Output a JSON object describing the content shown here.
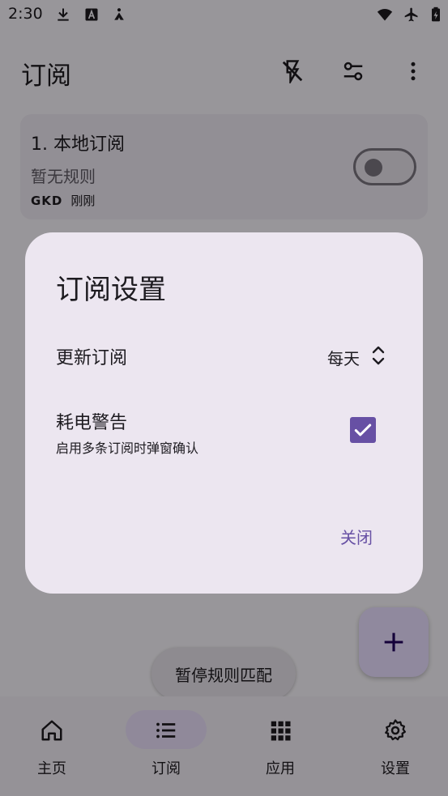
{
  "status_bar": {
    "time": "2:30",
    "left_icons": [
      "download-icon",
      "font-a-icon",
      "accessibility-icon"
    ],
    "right_icons": [
      "wifi-icon",
      "airplane-icon",
      "battery-charging-icon"
    ]
  },
  "app_bar": {
    "title": "订阅",
    "actions": [
      "flash-off-icon",
      "filter-settings-icon",
      "more-vert-icon"
    ]
  },
  "subscription": {
    "title": "1. 本地订阅",
    "desc": "暂无规则",
    "source": "GKD",
    "time": "刚刚",
    "enabled": false
  },
  "fab": {
    "icon": "plus-icon"
  },
  "pause_chip": {
    "label": "暂停规则匹配"
  },
  "bottom_nav": {
    "items": [
      {
        "label": "主页",
        "icon": "home-icon",
        "selected": false
      },
      {
        "label": "订阅",
        "icon": "list-icon",
        "selected": true
      },
      {
        "label": "应用",
        "icon": "apps-grid-icon",
        "selected": false
      },
      {
        "label": "设置",
        "icon": "gear-icon",
        "selected": false
      }
    ]
  },
  "dialog": {
    "title": "订阅设置",
    "update": {
      "label": "更新订阅",
      "value": "每天"
    },
    "warning": {
      "label": "耗电警告",
      "desc": "启用多条订阅时弹窗确认",
      "checked": true
    },
    "close_label": "关闭"
  },
  "colors": {
    "accent": "#6750a4",
    "dialog_bg": "#ece6f0",
    "fab_bg": "#e9ddff",
    "nav_indicator": "#e8def8"
  }
}
